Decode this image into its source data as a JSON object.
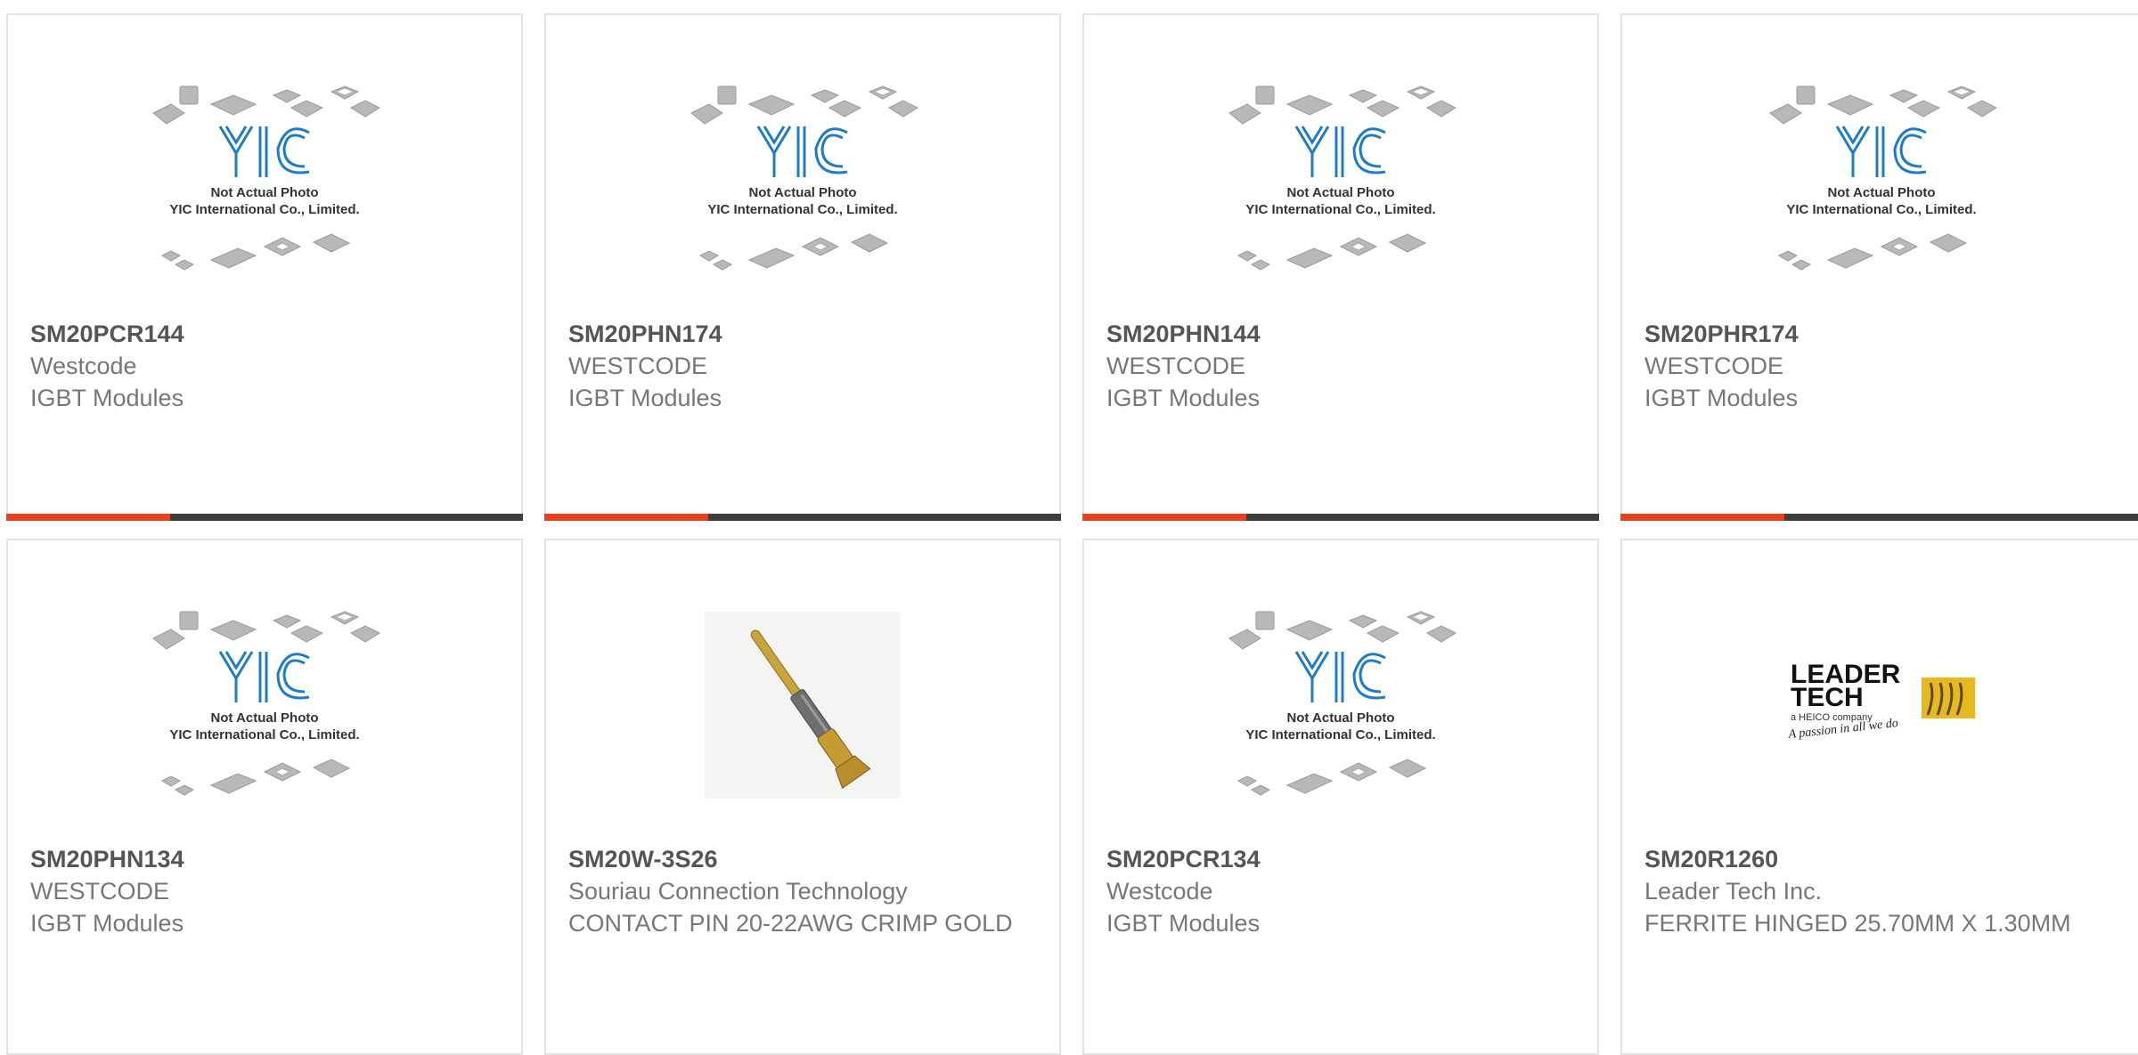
{
  "placeholder": {
    "brand": "YIC",
    "line1": "Not Actual Photo",
    "line2": "YIC International Co., Limited."
  },
  "leader_logo": {
    "line1": "LEADER",
    "line2": "TECH",
    "tag": "a HEICO company",
    "slogan": "A passion in all we do"
  },
  "colors": {
    "accent": "#e8411c",
    "bar": "#3d3d3d",
    "border": "#e3e3e3",
    "yic_blue": "#1f7cc3"
  },
  "products": [
    {
      "part": "SM20PCR144",
      "manufacturer": "Westcode",
      "description": "IGBT Modules",
      "image": "yic-placeholder"
    },
    {
      "part": "SM20PHN174",
      "manufacturer": "WESTCODE",
      "description": "IGBT Modules",
      "image": "yic-placeholder"
    },
    {
      "part": "SM20PHN144",
      "manufacturer": "WESTCODE",
      "description": "IGBT Modules",
      "image": "yic-placeholder"
    },
    {
      "part": "SM20PHR174",
      "manufacturer": "WESTCODE",
      "description": "IGBT Modules",
      "image": "yic-placeholder"
    },
    {
      "part": "SM20PHN134",
      "manufacturer": "WESTCODE",
      "description": "IGBT Modules",
      "image": "yic-placeholder"
    },
    {
      "part": "SM20W-3S26",
      "manufacturer": "Souriau Connection Technology",
      "description": "CONTACT PIN 20-22AWG CRIMP GOLD",
      "image": "contact-pin-photo"
    },
    {
      "part": "SM20PCR134",
      "manufacturer": "Westcode",
      "description": "IGBT Modules",
      "image": "yic-placeholder"
    },
    {
      "part": "SM20R1260",
      "manufacturer": "Leader Tech Inc.",
      "description": "FERRITE HINGED 25.70MM X 1.30MM",
      "image": "leader-tech-logo"
    }
  ]
}
